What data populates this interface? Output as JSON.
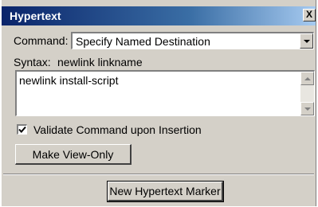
{
  "window": {
    "title": "Hypertext",
    "close_glyph": "X"
  },
  "command": {
    "label": "Command:",
    "value": "Specify Named Destination"
  },
  "syntax": {
    "label": "Syntax:",
    "value": "newlink linkname"
  },
  "editor": {
    "value": "newlink install-script"
  },
  "validate": {
    "label": "Validate Command upon Insertion",
    "checked": true
  },
  "buttons": {
    "make_view_only": "Make View-Only",
    "new_marker": "New Hypertext Marker"
  },
  "colors": {
    "title_bar_start": "#0a246a",
    "title_bar_end": "#a6caf0",
    "panel": "#d4d0c8"
  }
}
